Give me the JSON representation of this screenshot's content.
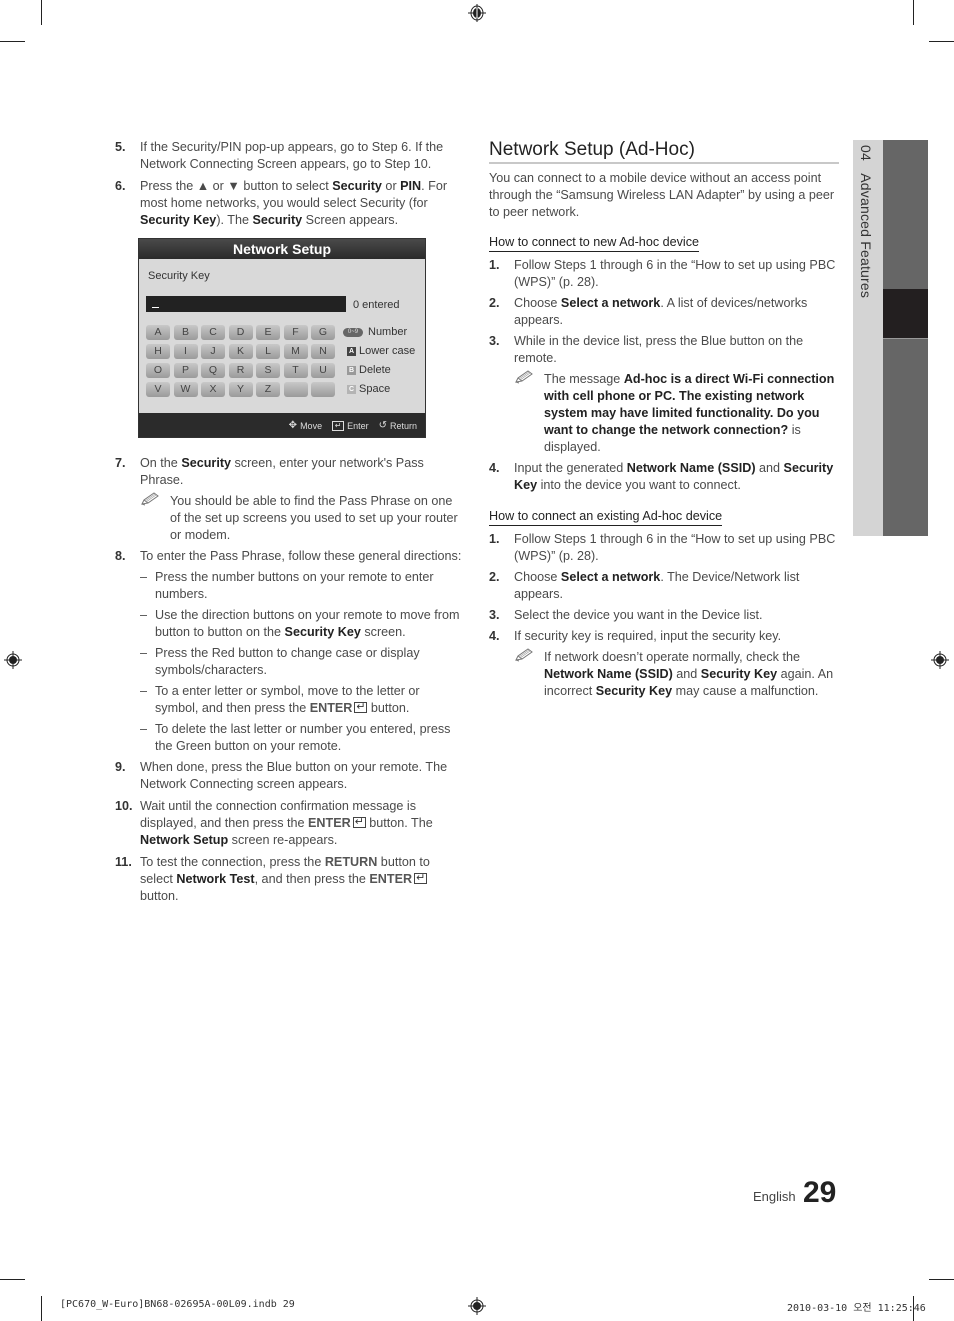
{
  "left_column": {
    "steps": [
      {
        "num": "5.",
        "parts": [
          {
            "t": "If the Security/PIN pop-up appears, go to Step 6. If the Network Connecting Screen appears, go to Step 10.",
            "b": false
          }
        ]
      },
      {
        "num": "6.",
        "parts": [
          {
            "t": "Press the ▲ or ▼ button to select ",
            "b": false
          },
          {
            "t": "Security",
            "b": true
          },
          {
            "t": " or ",
            "b": false
          },
          {
            "t": "PIN",
            "b": true
          },
          {
            "t": ". For most home networks, you would select Security (for ",
            "b": false
          },
          {
            "t": "Security Key",
            "b": true
          },
          {
            "t": "). The ",
            "b": false
          },
          {
            "t": "Security",
            "b": true
          },
          {
            "t": " Screen appears.",
            "b": false
          }
        ]
      }
    ],
    "tv_screen": {
      "title": "Network Setup",
      "field_label": "Security Key",
      "entered_count": "0 entered",
      "keys": [
        "A",
        "B",
        "C",
        "D",
        "E",
        "F",
        "G",
        "H",
        "I",
        "J",
        "K",
        "L",
        "M",
        "N",
        "O",
        "P",
        "Q",
        "R",
        "S",
        "T",
        "U",
        "V",
        "W",
        "X",
        "Y",
        "Z",
        "",
        ""
      ],
      "legend": [
        {
          "badge": "0~9",
          "label": "Number",
          "type": "pill",
          "color": "#666666"
        },
        {
          "badge": "A",
          "label": "Lower case",
          "type": "square",
          "color": "#444444"
        },
        {
          "badge": "B",
          "label": "Delete",
          "type": "square",
          "color": "#9a9a9a"
        },
        {
          "badge": "C",
          "label": "Space",
          "type": "square",
          "color": "#b4b4b4"
        }
      ],
      "footer": {
        "move": "Move",
        "enter": "Enter",
        "return": "Return"
      }
    },
    "step7": {
      "num": "7.",
      "pre": "On the ",
      "bold": "Security",
      "post": " screen, enter your network's Pass Phrase.",
      "note": "You should be able to find the Pass Phrase on one of the set up screens you used to set up your router or modem."
    },
    "step8": {
      "num": "8.",
      "text": "To enter the Pass Phrase, follow these general directions:",
      "dashes": [
        {
          "pre": "Press the number buttons on your remote to enter numbers.",
          "bold": "",
          "post": "",
          "enter": false
        },
        {
          "pre": "Use the direction buttons on your remote to move from button to button on the ",
          "bold": "Security Key",
          "post": " screen.",
          "enter": false
        },
        {
          "pre": "Press the Red button to change case or display symbols/characters.",
          "bold": "",
          "post": "",
          "enter": false
        },
        {
          "pre": "To a enter letter or symbol, move to the letter or symbol, and then press the ",
          "bold": "ENTER",
          "post": " button.",
          "enter": true
        },
        {
          "pre": "To delete the last letter or number you entered, press the Green button on your remote.",
          "bold": "",
          "post": "",
          "enter": false
        }
      ]
    },
    "step9": {
      "num": "9.",
      "text": "When done, press the Blue button on your remote. The Network Connecting screen appears."
    },
    "step10": {
      "num": "10.",
      "pre": "Wait until the connection confirmation message is displayed, and then press the ",
      "enter": "ENTER",
      "mid": " button. The ",
      "bold": "Network Setup",
      "post": " screen re-appears."
    },
    "step11": {
      "num": "11.",
      "pre": "To test the connection, press the ",
      "ret": "RETURN",
      "mid": " button to select ",
      "bold": "Network Test",
      "mid2": ", and then press the ",
      "enter": "ENTER",
      "post": " button."
    }
  },
  "right_column": {
    "title": "Network Setup (Ad-Hoc)",
    "intro": "You can connect to a mobile device without an access point through the “Samsung Wireless LAN Adapter” by using a peer to peer network.",
    "section1": {
      "heading": "How to connect to new Ad-hoc device",
      "s1": {
        "num": "1.",
        "text": "Follow Steps 1 through 6 in the “How to set up using PBC (WPS)” (p. 28)."
      },
      "s2": {
        "num": "2.",
        "pre": "Choose ",
        "bold": "Select a network",
        "post": ". A list of devices/networks appears."
      },
      "s3": {
        "num": "3.",
        "text": "While in the device list, press the Blue button on the remote.",
        "note_pre": "The message ",
        "note_bold": "Ad-hoc is a direct Wi-Fi connection with cell phone or PC. The existing network system may have limited functionality. Do you want to change the network connection?",
        "note_post": " is displayed."
      },
      "s4": {
        "num": "4.",
        "pre": "Input the generated ",
        "bold1": "Network Name (SSID)",
        "mid": " and ",
        "bold2": "Security Key",
        "post": " into the device you want to connect."
      }
    },
    "section2": {
      "heading": "How to connect an existing Ad-hoc device",
      "s1": {
        "num": "1.",
        "text": "Follow Steps 1 through 6 in the “How to set up using PBC (WPS)” (p. 28)."
      },
      "s2": {
        "num": "2.",
        "pre": "Choose ",
        "bold": "Select a network",
        "post": ". The Device/Network list appears."
      },
      "s3": {
        "num": "3.",
        "text": "Select the device you want in the Device list."
      },
      "s4": {
        "num": "4.",
        "text": "If security key is required, input the security key.",
        "note_pre": "If network doesn’t operate normally, check the ",
        "b1": "Network Name (SSID)",
        "m1": " and ",
        "b2": "Security Key",
        "m2": " again. An incorrect ",
        "b3": "Security Key",
        "note_post": " may cause a malfunction."
      }
    }
  },
  "side_tab": {
    "chapter": "04",
    "label": "Advanced Features"
  },
  "footer": {
    "language": "English",
    "page_number": "29",
    "slug_left": "[PC670_W-Euro]BN68-02695A-00L09.indb   29",
    "slug_right": "2010-03-10   오전 11:25:46"
  }
}
